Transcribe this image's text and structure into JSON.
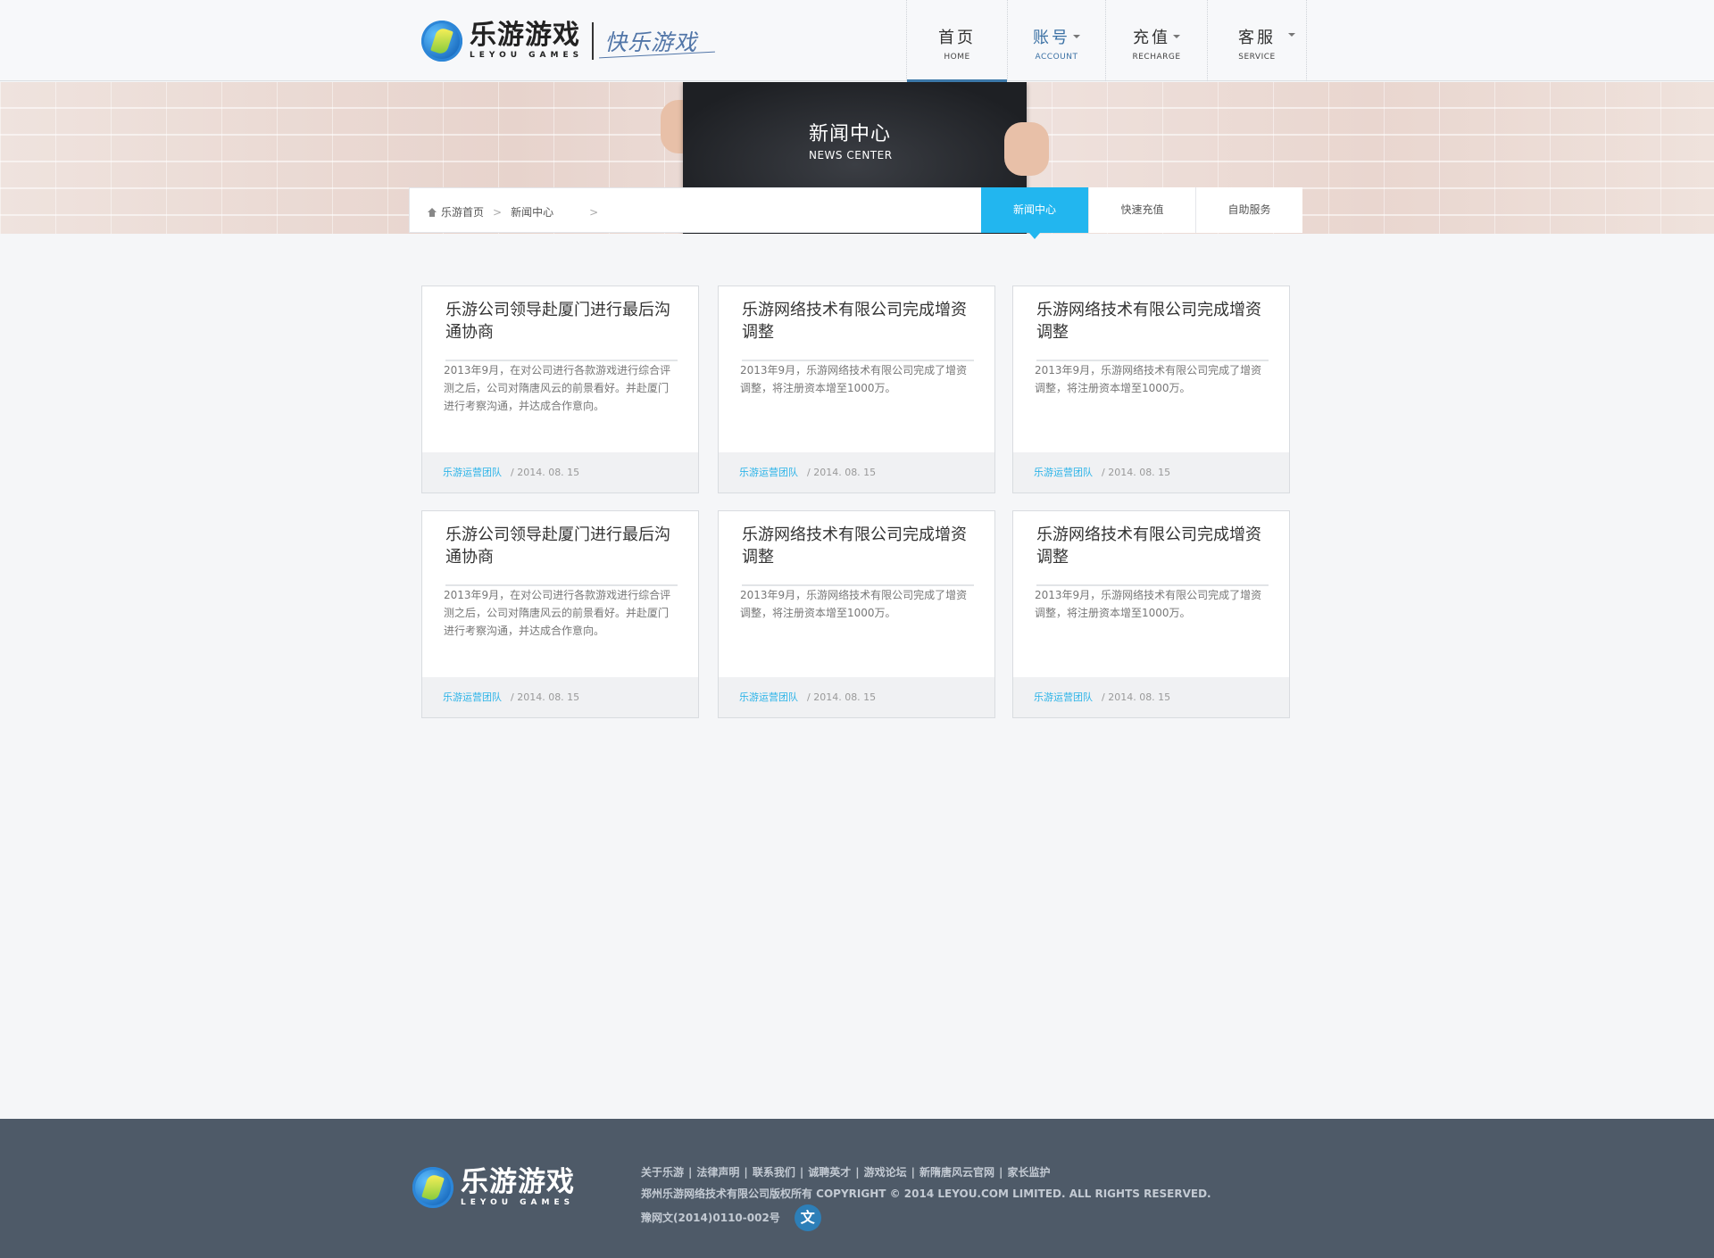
{
  "header": {
    "logo_cn": "乐游游戏",
    "logo_en": "LEYOU GAMES",
    "slogan": "快乐游戏",
    "nav": [
      {
        "cn": "首页",
        "en": "HOME"
      },
      {
        "cn": "账号",
        "en": "ACCOUNT"
      },
      {
        "cn": "充值",
        "en": "RECHARGE"
      },
      {
        "cn": "客服",
        "en": "SERVICE"
      }
    ]
  },
  "banner": {
    "title_cn": "新闻中心",
    "title_en": "NEWS CENTER"
  },
  "breadcrumb": {
    "home": "乐游首页",
    "current": "新闻中心"
  },
  "subtabs": [
    "新闻中心",
    "快速充值",
    "自助服务"
  ],
  "cards": [
    {
      "title": "乐游公司领导赴厦门进行最后沟通协商",
      "desc": "2013年9月，在对公司进行各款游戏进行综合评测之后，公司对隋唐风云的前景看好。并赴厦门进行考察沟通，并达成合作意向。",
      "author": "乐游运营团队",
      "date": "/ 2014. 08. 15"
    },
    {
      "title": "乐游网络技术有限公司完成增资调整",
      "desc": "2013年9月，乐游网络技术有限公司完成了增资调整，将注册资本增至1000万。",
      "author": "乐游运营团队",
      "date": "/ 2014. 08. 15"
    },
    {
      "title": "乐游网络技术有限公司完成增资调整",
      "desc": "2013年9月，乐游网络技术有限公司完成了增资调整，将注册资本增至1000万。",
      "author": "乐游运营团队",
      "date": "/ 2014. 08. 15"
    },
    {
      "title": "乐游公司领导赴厦门进行最后沟通协商",
      "desc": "2013年9月，在对公司进行各款游戏进行综合评测之后，公司对隋唐风云的前景看好。并赴厦门进行考察沟通，并达成合作意向。",
      "author": "乐游运营团队",
      "date": "/ 2014. 08. 15"
    },
    {
      "title": "乐游网络技术有限公司完成增资调整",
      "desc": "2013年9月，乐游网络技术有限公司完成了增资调整，将注册资本增至1000万。",
      "author": "乐游运营团队",
      "date": "/ 2014. 08. 15"
    },
    {
      "title": "乐游网络技术有限公司完成增资调整",
      "desc": "2013年9月，乐游网络技术有限公司完成了增资调整，将注册资本增至1000万。",
      "author": "乐游运营团队",
      "date": "/ 2014. 08. 15"
    }
  ],
  "footer": {
    "links": [
      "关于乐游",
      "法律声明",
      "联系我们",
      "诚聘英才",
      "游戏论坛",
      "新隋唐风云官网",
      "家长监护"
    ],
    "copyright": "郑州乐游网络技术有限公司版权所有 COPYRIGHT © 2014 LEYOU.COM LIMITED. ALL RIGHTS RESERVED.",
    "license": "豫网文(2014)0110-002号",
    "license_icon_glyph": "文"
  },
  "colors": {
    "accent": "#22b6ef",
    "nav_active": "#3c78a8",
    "footer_bg": "#4e5a68"
  }
}
